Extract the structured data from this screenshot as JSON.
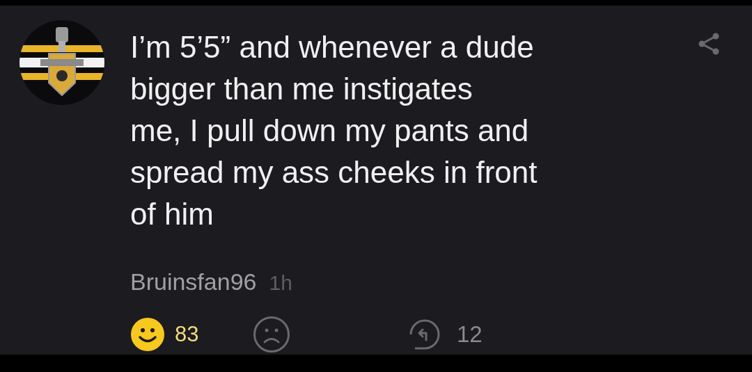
{
  "comment": {
    "text": "I’m 5’5” and whenever a dude\nbigger than me instigates\nme, I pull down my pants and\nspread my ass cheeks in front\nof him",
    "author": "Bruinsfan96",
    "time": "1h",
    "likes": "83",
    "liked": true,
    "disliked": false,
    "replies": "12"
  }
}
